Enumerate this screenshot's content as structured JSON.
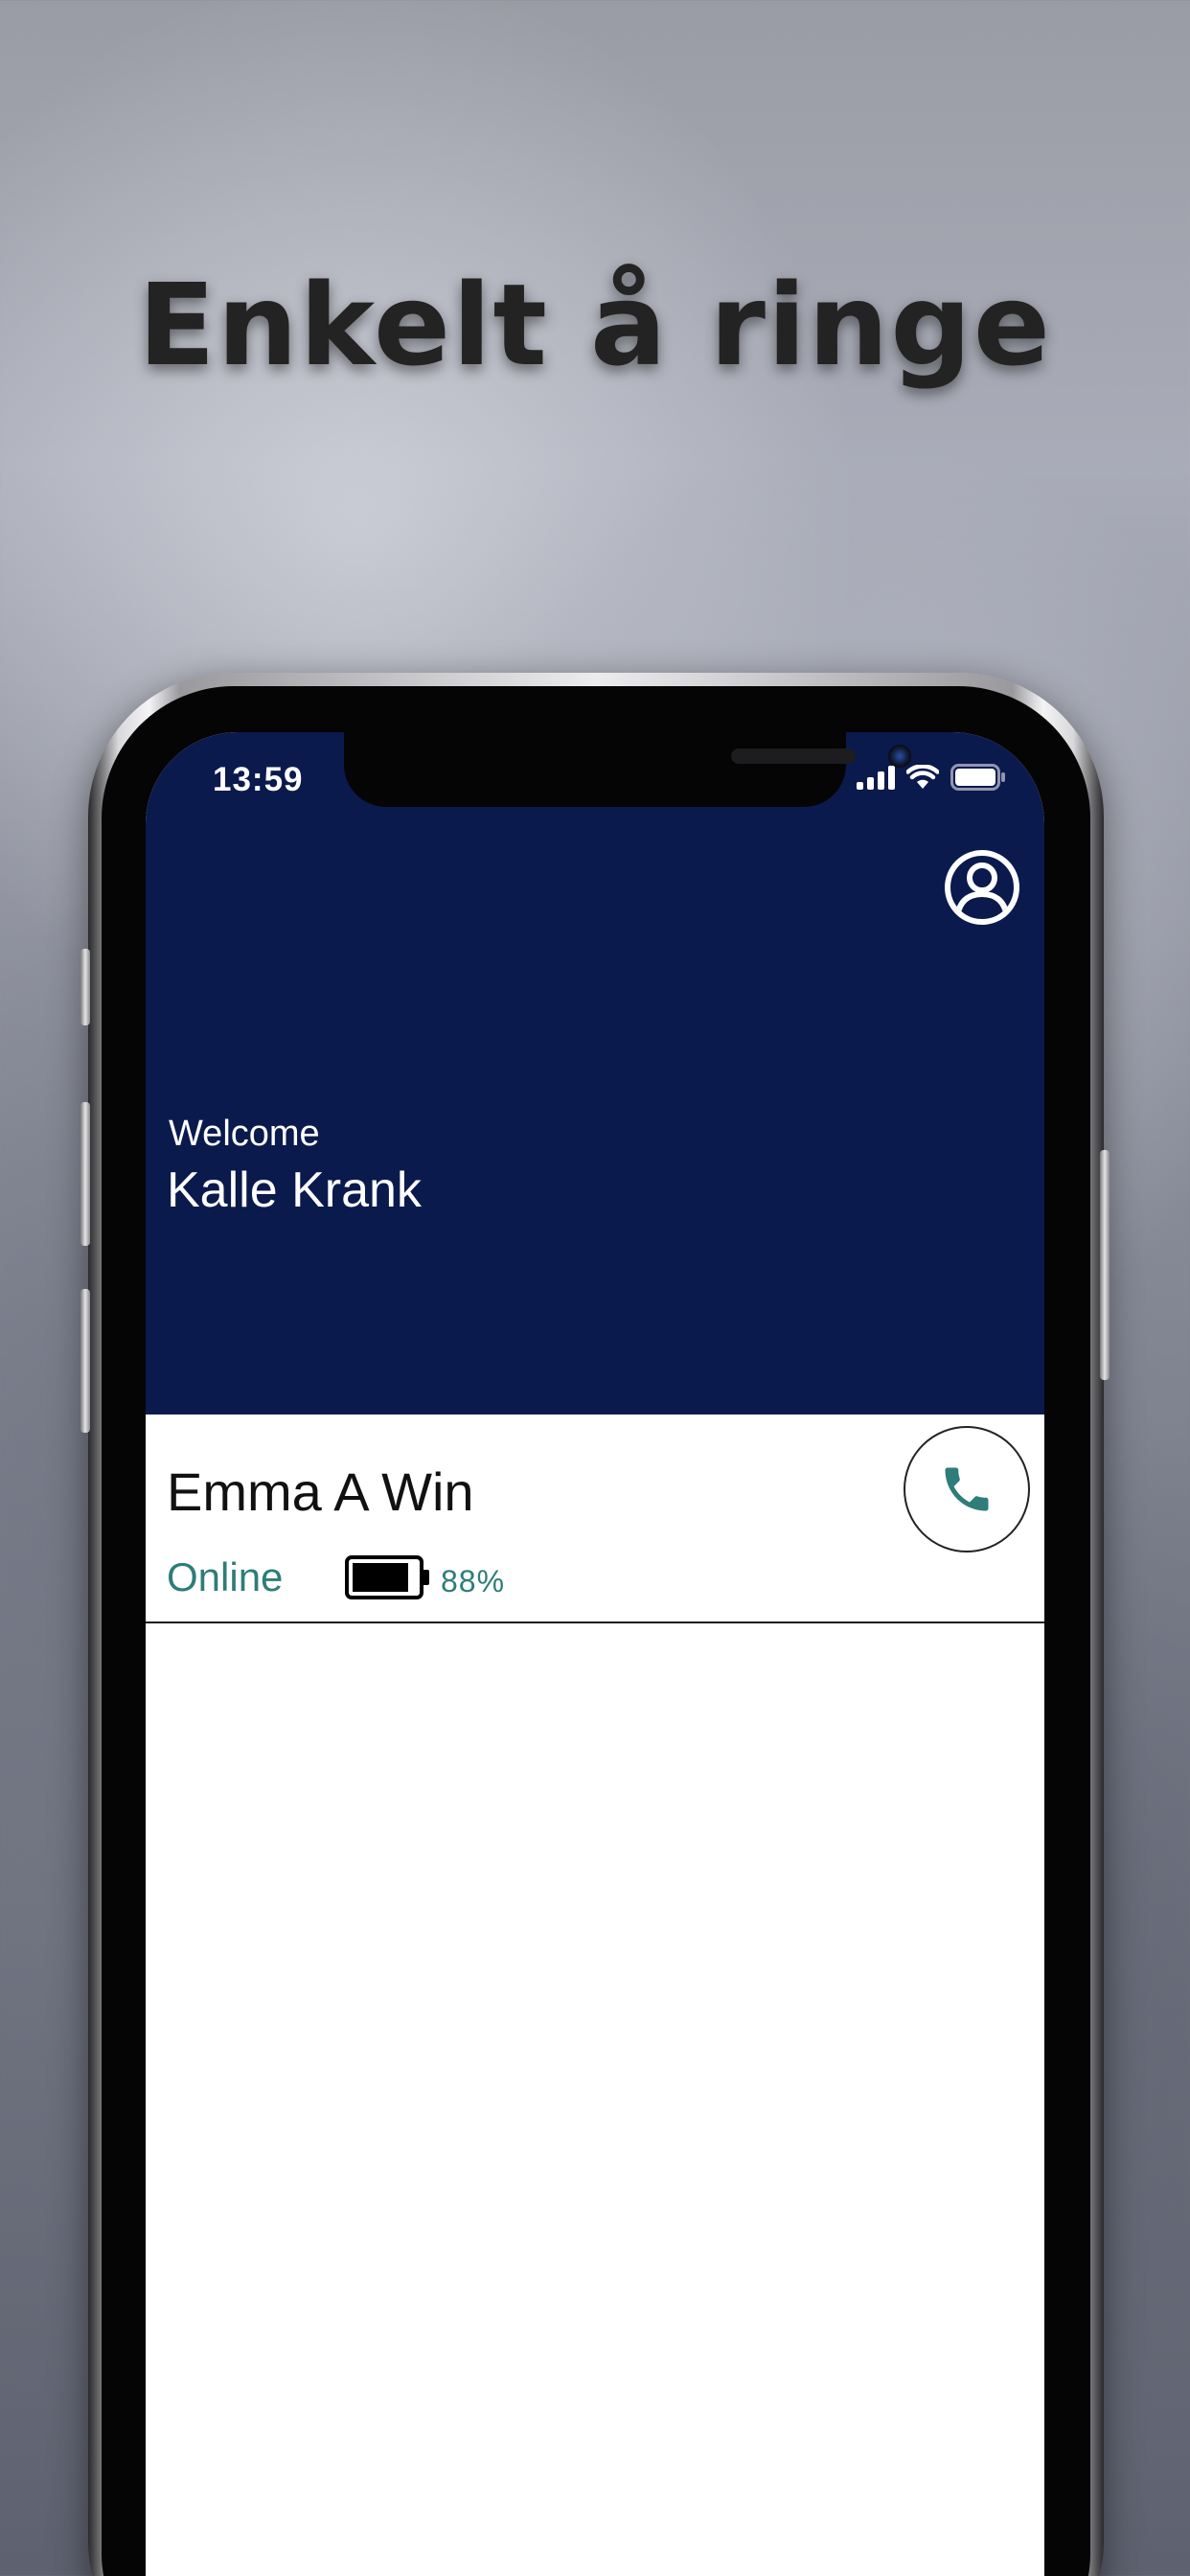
{
  "headline": "Enkelt å ringe",
  "status_bar": {
    "time": "13:59",
    "icons": [
      "cellular-signal-icon",
      "wifi-icon",
      "battery-icon"
    ]
  },
  "header": {
    "profile_icon": "account-circle-icon",
    "welcome_label": "Welcome",
    "user_name": "Kalle Krank"
  },
  "contacts": [
    {
      "name": "Emma A Win",
      "status": "Online",
      "battery_percent_label": "88%",
      "battery_level": 0.88,
      "call_icon": "phone-icon"
    }
  ],
  "colors": {
    "header_background": "#0b1a4d",
    "accent_teal": "#2e7d78",
    "screen_background": "#ffffff"
  }
}
